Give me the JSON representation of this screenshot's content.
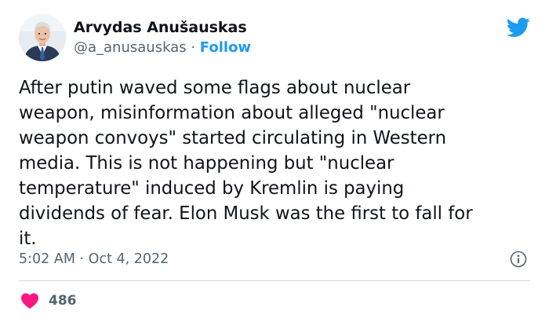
{
  "author": {
    "display_name": "Arvydas Anušauskas",
    "handle": "@a_anusauskas",
    "separator": "·",
    "follow_label": "Follow"
  },
  "tweet": {
    "text": "After putin waved some flags about nuclear\nweapon, misinformation about alleged \"nuclear\nweapon convoys\" started circulating in Western\nmedia. This is not happening but \"nuclear\ntemperature\" induced by Kremlin is paying\ndividends of fear. Elon Musk was the first to fall for\nit.",
    "time": "5:02 AM",
    "date_separator": "·",
    "date": "Oct 4, 2022"
  },
  "engagement": {
    "likes": "486"
  },
  "icons": {
    "brand": "twitter-bird-icon",
    "info": "info-icon",
    "like": "heart-icon"
  },
  "colors": {
    "accent": "#1d9bf0",
    "like": "#f91880",
    "text": "#0f1419",
    "muted": "#536471",
    "divider": "#cfd9de"
  }
}
